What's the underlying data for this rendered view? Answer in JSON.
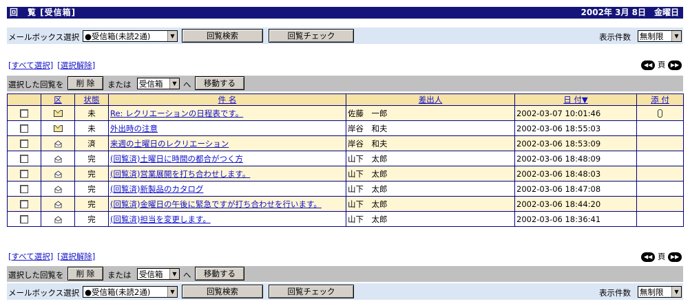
{
  "header": {
    "title": "回　覧 [受信箱]",
    "date": "2002年 3月 8日　金曜日"
  },
  "mailbox_bar": {
    "label": "メールボックス選択",
    "selected": "●受信箱(未読2通)",
    "search_button": "回覧検索",
    "check_button": "回覧チェック",
    "count_label": "表示件数",
    "count_value": "無制限"
  },
  "links": {
    "select_all": "[すべて選択]",
    "deselect": "[選択解除]"
  },
  "pager": {
    "page_label": "頁"
  },
  "action_bar": {
    "prefix": "選択した回覧を",
    "delete_button": "削 除",
    "or_text": "または",
    "folder_value": "受信箱",
    "to_text": "へ",
    "move_button": "移動する"
  },
  "table": {
    "headers": {
      "kubun": "区",
      "status": "状態",
      "subject": "件 名",
      "sender": "差出人",
      "date": "日 付▼",
      "attach": "添 付"
    },
    "rows": [
      {
        "icon": "envelope-closed",
        "status": "未",
        "subject": "Re: レクリエーションの日程表です。",
        "sender": "佐藤　一郎",
        "date": "2002-03-07 10:01:46",
        "attach": true
      },
      {
        "icon": "envelope-closed",
        "status": "未",
        "subject": "外出時の注意",
        "sender": "岸谷　和夫",
        "date": "2002-03-06 18:55:03",
        "attach": false
      },
      {
        "icon": "envelope-open",
        "status": "済",
        "subject": "来週の土曜日のレクリエーション",
        "sender": "岸谷　和夫",
        "date": "2002-03-06 18:53:09",
        "attach": false
      },
      {
        "icon": "envelope-open",
        "status": "完",
        "subject": "(回覧済)土曜日に時間の都合がつく方",
        "sender": "山下　太郎",
        "date": "2002-03-06 18:48:09",
        "attach": false
      },
      {
        "icon": "envelope-open",
        "status": "完",
        "subject": "(回覧済)営業展開を打ち合わせします。",
        "sender": "山下　太郎",
        "date": "2002-03-06 18:48:03",
        "attach": false
      },
      {
        "icon": "envelope-open",
        "status": "完",
        "subject": "(回覧済)新製品のカタログ",
        "sender": "山下　太郎",
        "date": "2002-03-06 18:47:08",
        "attach": false
      },
      {
        "icon": "envelope-open",
        "status": "完",
        "subject": "(回覧済)金曜日の午後に緊急ですが打ち合わせを行います。",
        "sender": "山下　太郎",
        "date": "2002-03-06 18:44:20",
        "attach": false
      },
      {
        "icon": "envelope-open",
        "status": "完",
        "subject": "(回覧済)担当を変更します。",
        "sender": "山下　太郎",
        "date": "2002-03-06 18:36:41",
        "attach": false
      }
    ]
  }
}
